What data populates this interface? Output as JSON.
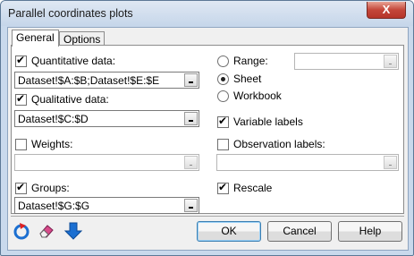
{
  "window": {
    "title": "Parallel coordinates plots",
    "close_label": "X"
  },
  "tabs": [
    {
      "label": "General"
    },
    {
      "label": "Options"
    }
  ],
  "left": {
    "quantitative": {
      "label": "Quantitative data:",
      "checked": true,
      "value": "Dataset!$A:$B;Dataset!$E:$E"
    },
    "qualitative": {
      "label": "Qualitative data:",
      "checked": true,
      "value": "Dataset!$C:$D"
    },
    "weights": {
      "label": "Weights:",
      "checked": false,
      "value": ""
    },
    "groups": {
      "label": "Groups:",
      "checked": true,
      "value": "Dataset!$G:$G"
    }
  },
  "right": {
    "range": {
      "label": "Range:",
      "selected": false,
      "value": ""
    },
    "sheet": {
      "label": "Sheet",
      "selected": true
    },
    "workbook": {
      "label": "Workbook",
      "selected": false
    },
    "variable_labels": {
      "label": "Variable labels",
      "checked": true
    },
    "observation_labels": {
      "label": "Observation labels:",
      "checked": false,
      "value": ""
    },
    "rescale": {
      "label": "Rescale",
      "checked": true
    }
  },
  "footer": {
    "reset_icon": "reset-icon",
    "eraser_icon": "eraser-icon",
    "down_arrow_icon": "down-arrow-icon",
    "ok_label": "OK",
    "cancel_label": "Cancel",
    "help_label": "Help"
  },
  "colors": {
    "accent_blue": "#1b6fd1",
    "reset_red": "#e02020",
    "title_bar": "#c9d9ec"
  }
}
